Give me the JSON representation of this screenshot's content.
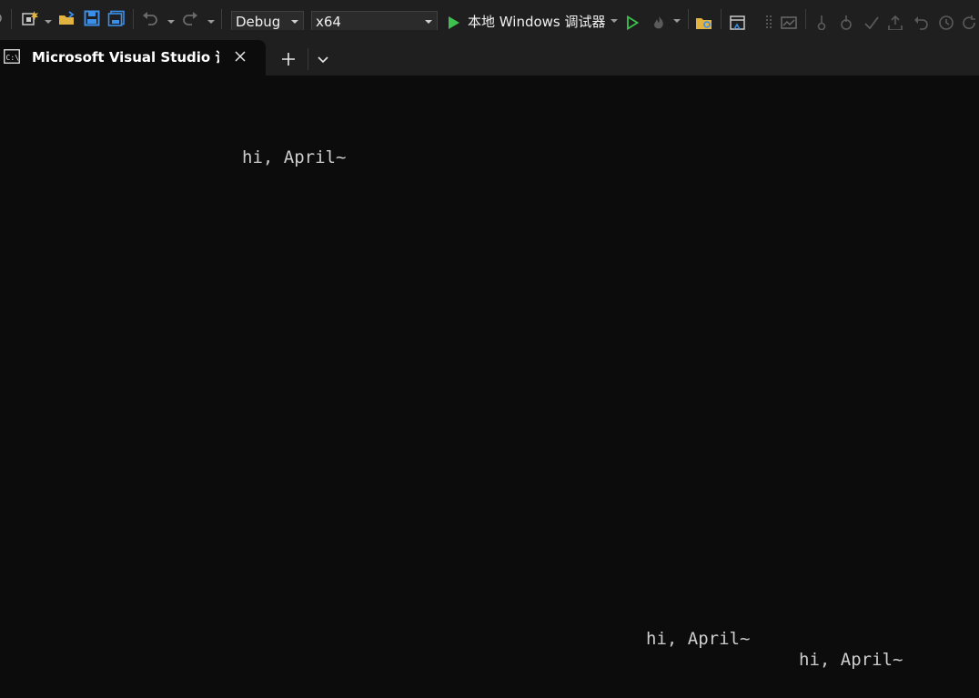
{
  "toolbar": {
    "configuration": "Debug",
    "platform": "x64",
    "run_target": "本地 Windows 调试器",
    "icons": [
      "new-project-icon",
      "open-folder-icon",
      "save-icon",
      "save-all-icon",
      "undo-icon",
      "redo-icon",
      "start-debugging-icon",
      "start-without-debugging-icon",
      "hot-reload-icon",
      "solution-explorer-icon",
      "window-layout-icon"
    ],
    "colors": {
      "run_green": "#3fc14f",
      "save_blue": "#3b8fe8",
      "folder_yellow": "#e3b341"
    }
  },
  "tabbar": {
    "active_tab_title": "Microsoft Visual Studio 调试控制台",
    "tab_icon": "console-icon",
    "close_icon": "close-icon",
    "new_tab_icon": "plus-icon",
    "dropdown_icon": "chevron-down-icon"
  },
  "terminal": {
    "background": "#0c0c0c",
    "text_color": "#cccccc",
    "lines": [
      "hi, April~",
      "hi, April~",
      "hi, April~"
    ]
  }
}
